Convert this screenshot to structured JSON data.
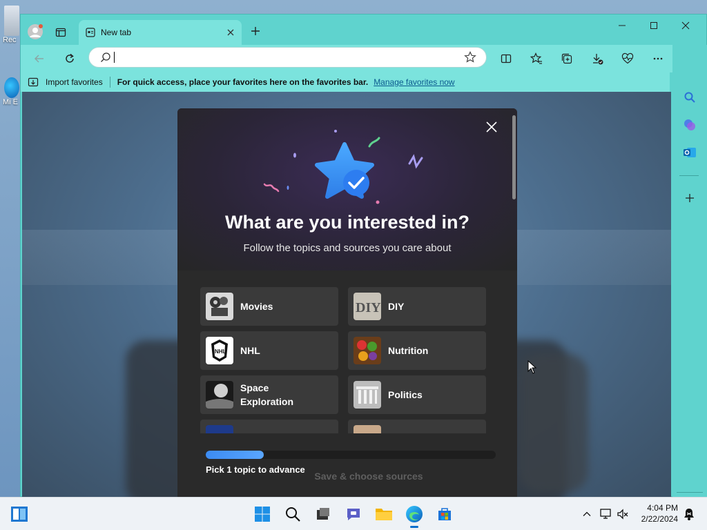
{
  "desktop": {
    "icon1_label": "Rec",
    "icon2_label": "Mi E"
  },
  "browser": {
    "tab_title": "New tab",
    "address": {
      "value": "",
      "placeholder": ""
    },
    "favorites_bar": {
      "import_label": "Import favorites",
      "message": "For quick access, place your favorites here on the favorites bar.",
      "manage_link": "Manage favorites now"
    }
  },
  "dialog": {
    "title": "What are you interested in?",
    "subtitle": "Follow the topics and sources you care about",
    "topics": [
      {
        "label": "Movies"
      },
      {
        "label": "DIY"
      },
      {
        "label": "NHL"
      },
      {
        "label": "Nutrition"
      },
      {
        "label": "Space Exploration"
      },
      {
        "label": "Politics"
      },
      {
        "label": ""
      },
      {
        "label": ""
      }
    ],
    "progress_fraction": 0.2,
    "pick_text": "Pick 1 topic to advance",
    "save_button": "Save & choose sources"
  },
  "taskbar": {
    "time": "4:04 PM",
    "date": "2/22/2024"
  },
  "colors": {
    "window_frame": "#5fd3ce",
    "toolbar": "#7be3dd",
    "dialog_bg": "#2a2a2a",
    "progress": "#3c8bf2",
    "link": "#0b5a8e"
  }
}
